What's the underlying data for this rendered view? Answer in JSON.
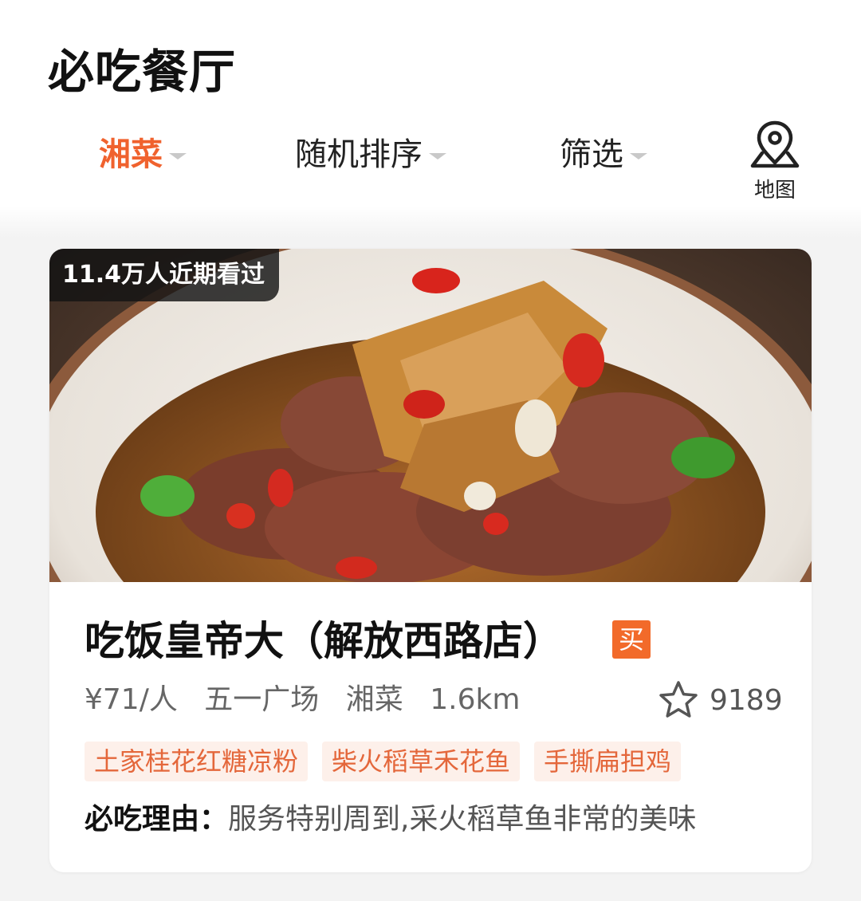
{
  "page": {
    "title": "必吃餐厅"
  },
  "filters": {
    "cuisine": "湘菜",
    "sort": "随机排序",
    "filter": "筛选",
    "map_label": "地图"
  },
  "icons": {
    "caret": "caret-down-icon",
    "map": "map-pin-icon",
    "favorite": "star-outline-icon"
  },
  "colors": {
    "accent": "#f0622e",
    "tag_bg": "#fdf0ea",
    "buy_badge": "#f26a2a"
  },
  "restaurant": {
    "views_badge": "11.4万人近期看过",
    "name": "吃饭皇帝大（解放西路店）",
    "buy_badge": "买",
    "price": "¥71/人",
    "area": "五一广场",
    "cuisine": "湘菜",
    "distance": "1.6km",
    "favorite_count": "9189",
    "tags": [
      "土家桂花红糖凉粉",
      "柴火稻草禾花鱼",
      "手撕扁担鸡"
    ],
    "reason_label": "必吃理由：",
    "reason_text": "服务特别周到,采火稻草鱼非常的美味"
  }
}
